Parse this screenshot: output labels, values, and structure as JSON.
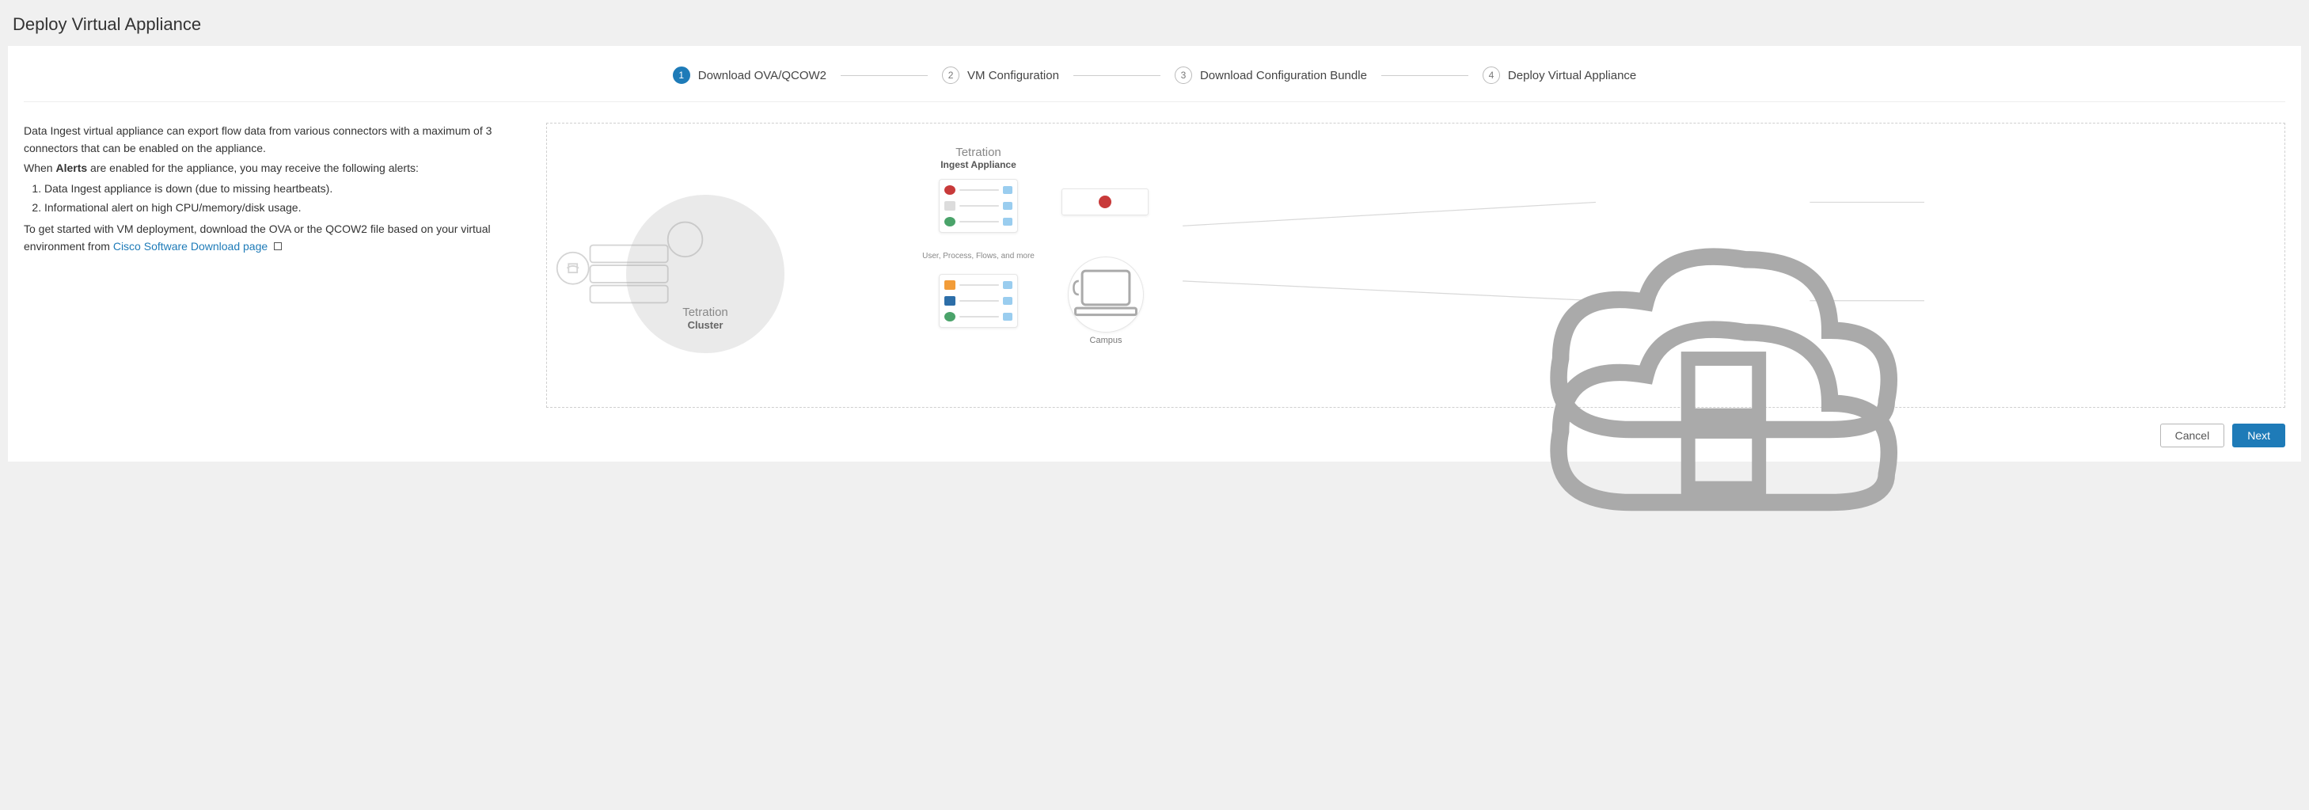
{
  "page_title": "Deploy Virtual Appliance",
  "stepper": {
    "steps": [
      {
        "num": "1",
        "label": "Download OVA/QCOW2",
        "active": true
      },
      {
        "num": "2",
        "label": "VM Configuration",
        "active": false
      },
      {
        "num": "3",
        "label": "Download Configuration Bundle",
        "active": false
      },
      {
        "num": "4",
        "label": "Deploy Virtual Appliance",
        "active": false
      }
    ]
  },
  "description": {
    "intro": "Data Ingest virtual appliance can export flow data from various connectors with a maximum of 3 connectors that can be enabled on the appliance.",
    "when_prefix": "When ",
    "alerts_bold": "Alerts",
    "when_suffix": " are enabled for the appliance, you may receive the following alerts:",
    "items": [
      "Data Ingest appliance is down (due to missing heartbeats).",
      "Informational alert on high CPU/memory/disk usage."
    ],
    "get_started_prefix": "To get started with VM deployment, download the OVA or the QCOW2 file based on your virtual environment from ",
    "link_text": "Cisco Software Download page"
  },
  "diagram": {
    "cluster_title": "Tetration",
    "cluster_sub": "Cluster",
    "ingest_title": "Tetration",
    "ingest_sub": "Ingest Appliance",
    "upf_label": "User, Process, Flows, and more",
    "campus_label": "Campus",
    "card_top_rows": [
      "f5-icon",
      "netscaler-icon",
      "globe-icon"
    ],
    "card_bot_rows": [
      "aws-icon",
      "box-icon",
      "globe-icon"
    ]
  },
  "footer": {
    "cancel": "Cancel",
    "next": "Next"
  }
}
